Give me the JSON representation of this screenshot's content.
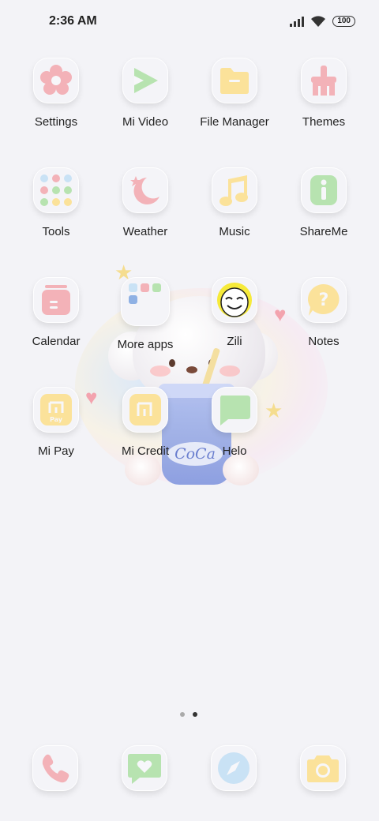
{
  "status_bar": {
    "time": "2:36 AM",
    "battery": "100",
    "icons": [
      "signal-icon",
      "wifi-icon",
      "battery-icon"
    ]
  },
  "apps": [
    {
      "label": "Settings",
      "icon": "flower-gear-icon"
    },
    {
      "label": "Mi Video",
      "icon": "play-icon"
    },
    {
      "label": "File Manager",
      "icon": "folder-icon"
    },
    {
      "label": "Themes",
      "icon": "brush-icon"
    },
    {
      "label": "Tools",
      "icon": "tools-folder-icon"
    },
    {
      "label": "Weather",
      "icon": "moon-star-icon"
    },
    {
      "label": "Music",
      "icon": "music-note-icon"
    },
    {
      "label": "ShareMe",
      "icon": "info-icon"
    },
    {
      "label": "Calendar",
      "icon": "calendar-icon"
    },
    {
      "label": "More apps",
      "icon": "apps-folder-icon"
    },
    {
      "label": "Zili",
      "icon": "zili-face-icon"
    },
    {
      "label": "Notes",
      "icon": "question-bubble-icon"
    },
    {
      "label": "Mi Pay",
      "icon": "mi-pay-icon"
    },
    {
      "label": "Mi Credit",
      "icon": "mi-credit-icon"
    },
    {
      "label": "Helo",
      "icon": "chat-bubble-icon"
    }
  ],
  "mi_pay_tile_text": "MI\nPay",
  "mi_credit_tile_text": "MI",
  "pager": {
    "pages": 2,
    "active": 2
  },
  "dock": [
    {
      "name": "phone",
      "icon": "phone-icon"
    },
    {
      "name": "messages",
      "icon": "message-heart-icon"
    },
    {
      "name": "browser",
      "icon": "compass-icon"
    },
    {
      "name": "camera",
      "icon": "camera-icon"
    }
  ],
  "wallpaper": {
    "cup_text": "CoCa"
  },
  "colors": {
    "background": "#f3f3f7",
    "pink": "#f3b2b8",
    "green": "#b7e3b0",
    "yellow": "#fbe29a",
    "blue": "#c9e2f5"
  }
}
